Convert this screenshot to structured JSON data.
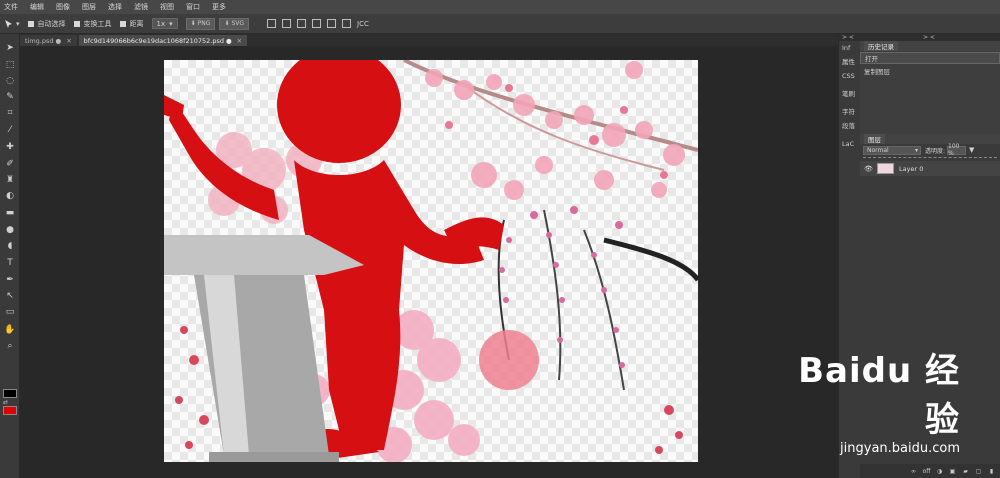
{
  "menu": [
    "文件",
    "编辑",
    "图像",
    "图层",
    "选择",
    "滤镜",
    "视图",
    "窗口",
    "更多"
  ],
  "options": {
    "auto_select": "自动选择",
    "transform": "变换工具",
    "distance": "距离",
    "zoom": "1x",
    "png": "PNG",
    "svg": "SVG",
    "jsx": "JCC"
  },
  "tabs": [
    {
      "label": "timg.psd"
    },
    {
      "label": "bfc9d149066b6c9e19dac1068f210752.psd"
    }
  ],
  "mini_panel": {
    "toggle": "> <",
    "items": [
      "Inf",
      "属性",
      "CSS",
      "笔刷",
      "字符",
      "段落",
      "LaC"
    ]
  },
  "right_panel": {
    "toggle": "> <",
    "history_tab": "历史记录",
    "history": [
      "打开",
      "复制图层"
    ],
    "layers_tab": "图层",
    "blend_mode": "Normal",
    "opacity_label": "透明度:",
    "opacity_value": "100 %",
    "layer_name": "Layer 0",
    "footer_off": "off"
  },
  "watermark": {
    "main": "Baidu 经验",
    "sub": "jingyan.baidu.com"
  },
  "colors": {
    "foreground": "#000000",
    "background": "#e00000"
  }
}
